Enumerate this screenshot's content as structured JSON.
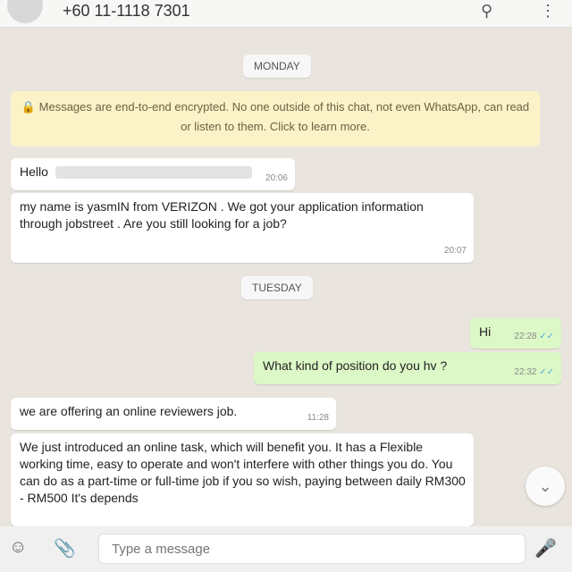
{
  "header": {
    "contact": "+60 11-1118 7301",
    "search_icon": "search-icon",
    "menu_icon": "kebab-menu-icon"
  },
  "chat": {
    "dates": [
      "MONDAY",
      "TUESDAY"
    ],
    "encryption_notice": "🔒 Messages are end-to-end encrypted. No one outside of this chat, not even WhatsApp, can read or listen to them. Click to learn more.",
    "messages": [
      {
        "text": "Hello",
        "time": "20:06"
      },
      {
        "text": "my name is yasmIN from VERIZON . We got your application information through jobstreet . Are you still looking for a job?",
        "time": "20:07"
      },
      {
        "text": "Hi",
        "time": "22:28",
        "ticks": "✓✓"
      },
      {
        "text": "What kind of position do you hv ?",
        "time": "22:32",
        "ticks": "✓✓"
      },
      {
        "text": "we are offering an online reviewers job.",
        "time": "11:28"
      },
      {
        "text": "We just introduced an online task, which will benefit you. It has a Flexible working time, easy to operate and won't interfere with other things you do. You can do as a part-time or full-time job if you so wish, paying between daily  RM300 - RM500 It's depends"
      }
    ]
  },
  "input": {
    "placeholder": "Type a message",
    "emoji_icon": "emoji-icon",
    "attach_icon": "paperclip-icon",
    "mic_icon": "microphone-icon"
  },
  "scroll_down_icon": "chevron-down-icon"
}
